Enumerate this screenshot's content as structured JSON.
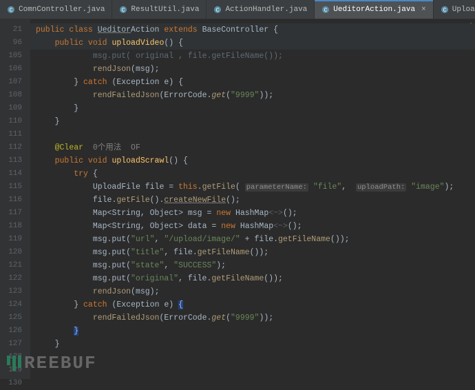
{
  "tabs": [
    {
      "label": "ComnController.java",
      "active": false
    },
    {
      "label": "ResultUtil.java",
      "active": false
    },
    {
      "label": "ActionHandler.java",
      "active": false
    },
    {
      "label": "UeditorAction.java",
      "active": true
    },
    {
      "label": "UploadFile.class",
      "active": false
    }
  ],
  "line_numbers": [
    "21",
    "96",
    "105",
    "106",
    "107",
    "108",
    "109",
    "110",
    "111",
    "112",
    "113",
    "114",
    "115",
    "116",
    "117",
    "118",
    "119",
    "120",
    "121",
    "122",
    "123",
    "124",
    "125",
    "126",
    "127",
    "128",
    "129",
    "130"
  ],
  "sticky": {
    "class_decl": {
      "kw1": "public class",
      "name": "Ueditor",
      "name2": "Action",
      "kw2": "extends",
      "base": "BaseController"
    },
    "method_decl": {
      "kw": "public void",
      "name": "uploadVideo"
    }
  },
  "body": {
    "dim1": "msg.put( original , file.getFileName());",
    "l106": {
      "fn": "rendJson",
      "arg": "msg"
    },
    "l107": {
      "kw1": "}",
      "kw2": "catch",
      "type": "Exception",
      "var": "e"
    },
    "l108": {
      "fn": "rendFailedJson",
      "cls": "ErrorCode",
      "m": "get",
      "arg": "\"9999\""
    },
    "annot": "@Clear",
    "annot_meta": "0个用法  OF",
    "l113": {
      "kw": "public void",
      "name": "uploadScrawl"
    },
    "try": "try",
    "l115": {
      "type": "UploadFile",
      "var": "file",
      "kw": "this",
      "m": "getFile",
      "p1k": "parameterName:",
      "p1v": "\"file\"",
      "p2k": "uploadPath:",
      "p2v": "\"image\""
    },
    "l116": {
      "v": "file",
      "m1": "getFile",
      "m2": "createNewFile"
    },
    "l117": {
      "t1": "Map",
      "g": "<String, Object>",
      "v": "msg",
      "kw": "new",
      "t2": "HashMap",
      "h": "<~>"
    },
    "l118": {
      "t1": "Map",
      "g": "<String, Object>",
      "v": "data",
      "kw": "new",
      "t2": "HashMap",
      "h": "<~>"
    },
    "l119": {
      "a1": "\"url\"",
      "a2": "\"/upload/image/\"",
      "m": "getFileName"
    },
    "l120": {
      "a1": "\"title\"",
      "m": "getFileName"
    },
    "l121": {
      "a1": "\"state\"",
      "a2": "\"SUCCESS\""
    },
    "l122": {
      "a1": "\"original\"",
      "m": "getFileName"
    },
    "l123": {
      "fn": "rendJson",
      "arg": "msg"
    },
    "l124": {
      "kw1": "}",
      "kw2": "catch",
      "type": "Exception",
      "var": "e"
    },
    "l125": {
      "fn": "rendFailedJson",
      "cls": "ErrorCode",
      "m": "get",
      "arg": "\"9999\""
    }
  },
  "watermark": "REEBUF"
}
